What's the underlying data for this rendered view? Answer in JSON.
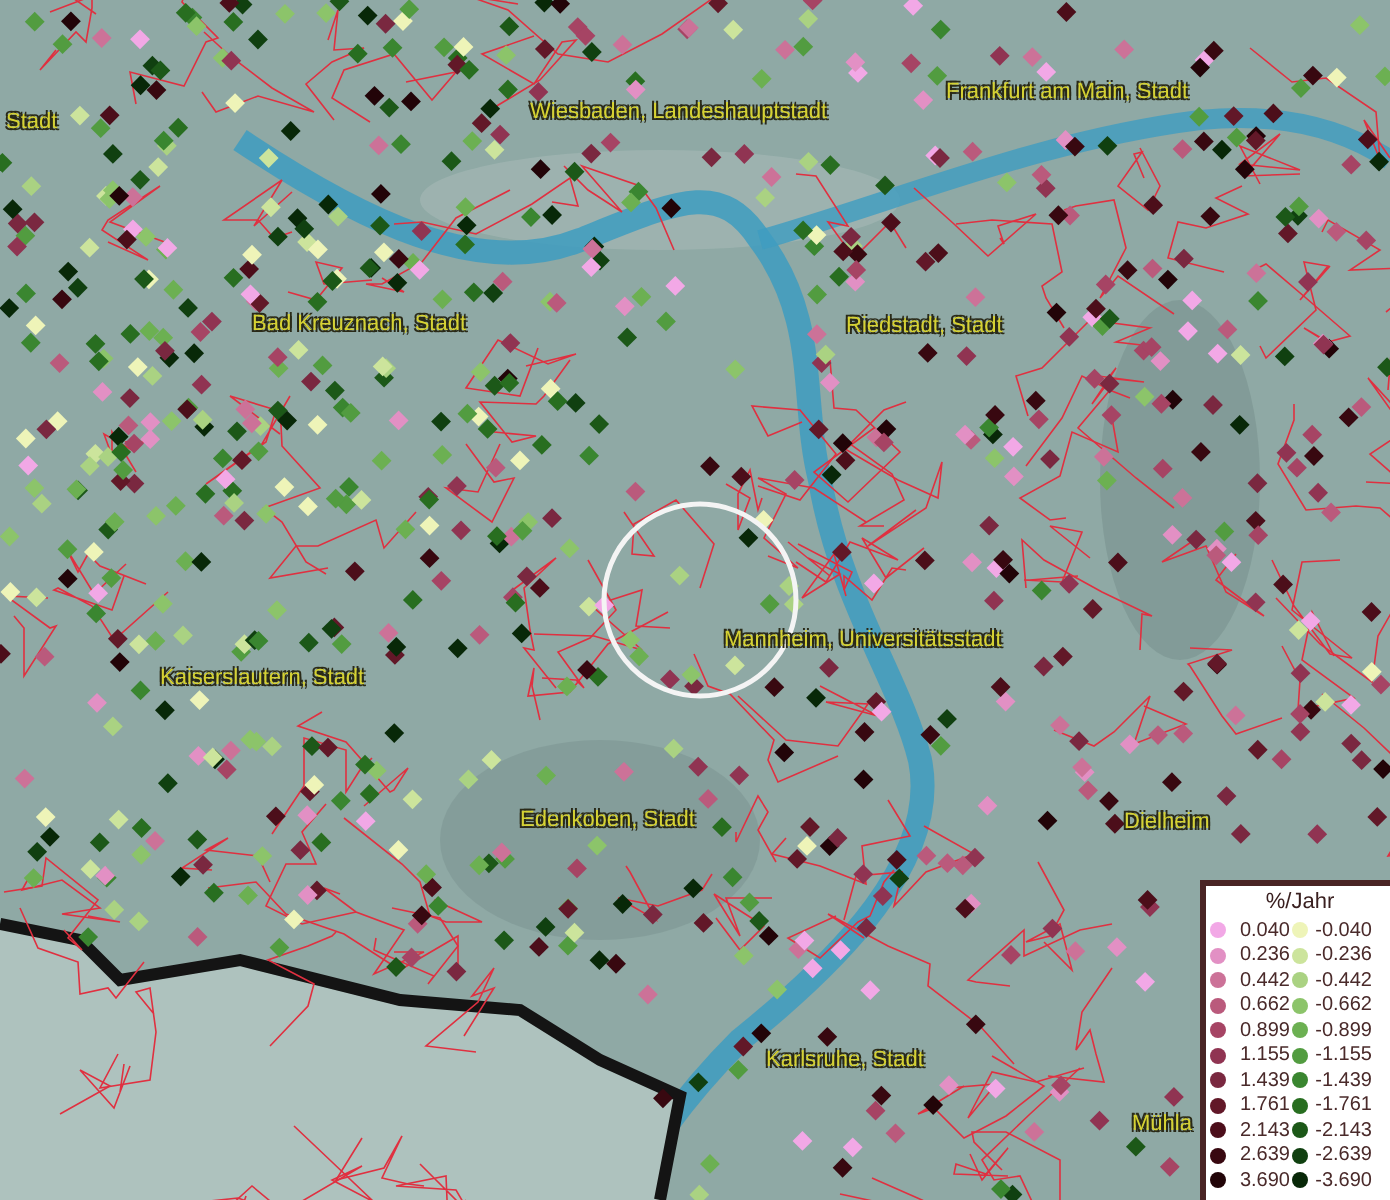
{
  "map_labels": [
    {
      "text": "Stadt"
    },
    {
      "text": "Wiesbaden, Landeshauptstadt"
    },
    {
      "text": "Frankfurt am Main, Stadt"
    },
    {
      "text": "Bad Kreuznach, Stadt"
    },
    {
      "text": "Riedstadt, Stadt"
    },
    {
      "text": "Mannheim, Universitätsstadt"
    },
    {
      "text": "Kaiserslautern, Stadt"
    },
    {
      "text": "Edenkoben, Stadt"
    },
    {
      "text": "Dielheim"
    },
    {
      "text": "Karlsruhe, Stadt"
    },
    {
      "text": "Mühla"
    }
  ],
  "legend": {
    "title": "%/Jahr",
    "columns": [
      [
        {
          "label": "0.040",
          "color": "#f2a8e6"
        },
        {
          "label": "0.236",
          "color": "#e290c4"
        },
        {
          "label": "0.442",
          "color": "#cc7298"
        },
        {
          "label": "0.662",
          "color": "#ba5a7c"
        },
        {
          "label": "0.899",
          "color": "#a64464"
        },
        {
          "label": "1.155",
          "color": "#903452"
        },
        {
          "label": "1.439",
          "color": "#7a2840"
        },
        {
          "label": "1.761",
          "color": "#621828"
        },
        {
          "label": "2.143",
          "color": "#4c0e1a"
        },
        {
          "label": "2.639",
          "color": "#380810"
        },
        {
          "label": "3.690",
          "color": "#220408"
        }
      ],
      [
        {
          "label": "-0.040",
          "color": "#eef4b8"
        },
        {
          "label": "-0.236",
          "color": "#cce49c"
        },
        {
          "label": "-0.442",
          "color": "#aad282"
        },
        {
          "label": "-0.662",
          "color": "#8cc46a"
        },
        {
          "label": "-0.899",
          "color": "#6cb052"
        },
        {
          "label": "-1.155",
          "color": "#529c40"
        },
        {
          "label": "-1.439",
          "color": "#3a8630"
        },
        {
          "label": "-1.761",
          "color": "#286e20"
        },
        {
          "label": "-2.143",
          "color": "#1c5818"
        },
        {
          "label": "-2.639",
          "color": "#104010"
        },
        {
          "label": "-3.690",
          "color": "#082808"
        }
      ]
    ]
  }
}
